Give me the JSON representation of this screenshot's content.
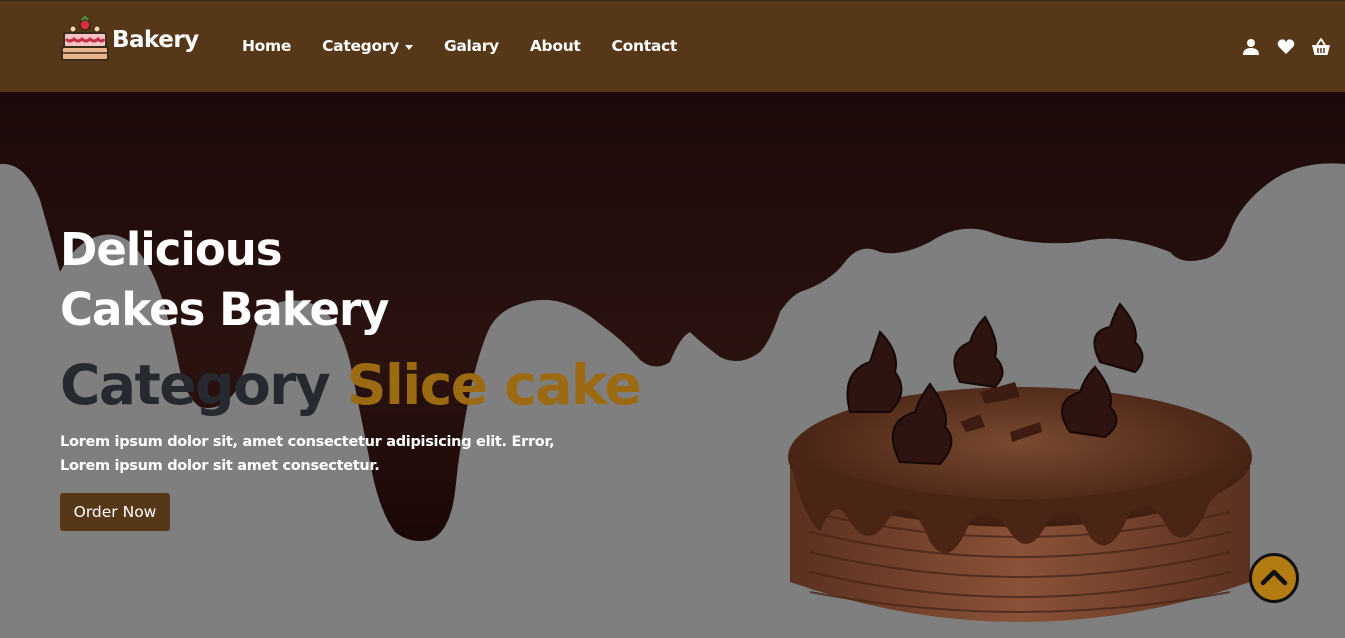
{
  "brand": {
    "name": "Bakery",
    "logo_icon": "cake-icon"
  },
  "nav": {
    "links": [
      "Home",
      "Category",
      "Galary",
      "About",
      "Contact"
    ],
    "icons": [
      "user-icon",
      "heart-icon",
      "basket-icon"
    ]
  },
  "hero": {
    "title_line1": "Delicious",
    "title_line2": "Cakes Bakery",
    "subtitle_part1": "Category",
    "subtitle_part2": "Slice cake",
    "description_line1": "Lorem ipsum dolor sit, amet consectetur adipisicing elit. Error,",
    "description_line2": "Lorem ipsum dolor sit amet consectetur.",
    "button_label": "Order Now",
    "scroll_icon": "chevron-up-icon"
  },
  "colors": {
    "navbar": "#563819",
    "hero_background": "#7f7f7f",
    "chocolate": "#1f0d0b",
    "accent_gold": "#9b6a12",
    "subtitle_dark": "#262a30",
    "button": "#563819",
    "scroll_button": "#b27c13"
  }
}
